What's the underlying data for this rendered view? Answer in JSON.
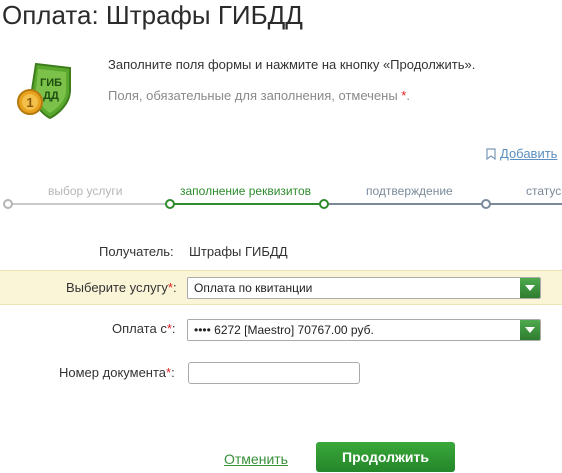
{
  "page": {
    "title": "Оплата: Штрафы ГИБДД"
  },
  "logo": {
    "shield_text_top": "ГИБ",
    "shield_text_bottom": "ДД",
    "coin_text": "1",
    "colors": {
      "shield": "#5aa82e",
      "coin": "#e7a21e"
    }
  },
  "intro": {
    "text": "Заполните поля формы и нажмите на кнопку «Продолжить».",
    "required_prefix": "Поля, обязательные для заполнения, отмечены ",
    "required_star": "*",
    "required_suffix": "."
  },
  "favorites": {
    "label": "Добавить"
  },
  "steps": [
    {
      "label": "выбор услуги",
      "state": "done"
    },
    {
      "label": "заполнение реквизитов",
      "state": "active"
    },
    {
      "label": "подтверждение",
      "state": "future"
    },
    {
      "label": "статус",
      "state": "future"
    }
  ],
  "form": {
    "recipient": {
      "label": "Получатель:",
      "value": "Штрафы ГИБДД"
    },
    "service": {
      "label": "Выберите услугу",
      "star": "*",
      "colon": ":",
      "selected": "Оплата по квитанции"
    },
    "pay_from": {
      "label": "Оплата с",
      "star": "*",
      "colon": ":",
      "selected": "•••• 6272  [Maestro] 70767.00 руб."
    },
    "document_number": {
      "label": "Номер документа",
      "star": "*",
      "colon": ":",
      "value": "",
      "placeholder": ""
    }
  },
  "actions": {
    "cancel_label": "Отменить",
    "continue_label": "Продолжить"
  },
  "colors": {
    "accent": "#2e8b2e",
    "required": "#e02020",
    "highlight": "#fbf5d8"
  }
}
